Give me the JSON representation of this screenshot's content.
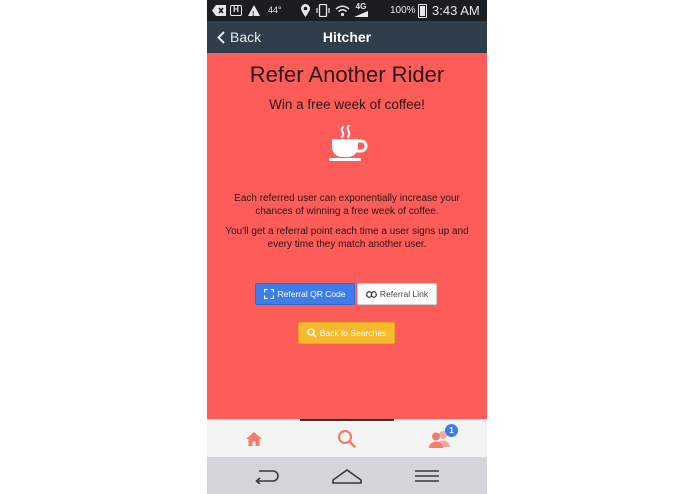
{
  "status_bar": {
    "temperature": "44°",
    "network": "4G",
    "battery_percent": "100%",
    "time": "3:43 AM"
  },
  "app_bar": {
    "back_label": "Back",
    "title": "Hitcher"
  },
  "main": {
    "heading": "Refer Another Rider",
    "subheading": "Win a free week of coffee!",
    "icon": "coffee-cup-icon",
    "paragraph_1": "Each referred user can exponentially increase your chances of winning a free week of coffee.",
    "paragraph_2": "You'll get a referral point each time a user signs up and every time they match another user.",
    "buttons": {
      "qr_code_label": "Referral QR Code",
      "link_label": "Referral Link",
      "back_to_searches_label": "Back to Searches"
    }
  },
  "tab_bar": {
    "tabs": [
      {
        "icon": "home-icon",
        "active": false
      },
      {
        "icon": "search-icon",
        "active": true
      },
      {
        "icon": "users-icon",
        "active": false,
        "badge": "1"
      }
    ]
  },
  "colors": {
    "content_background": "#fe5c58",
    "app_bar": "#2e3e4c",
    "primary_button": "#3b7ded",
    "warning_button": "#f7ba2c",
    "tab_icon": "#f57d6c"
  }
}
